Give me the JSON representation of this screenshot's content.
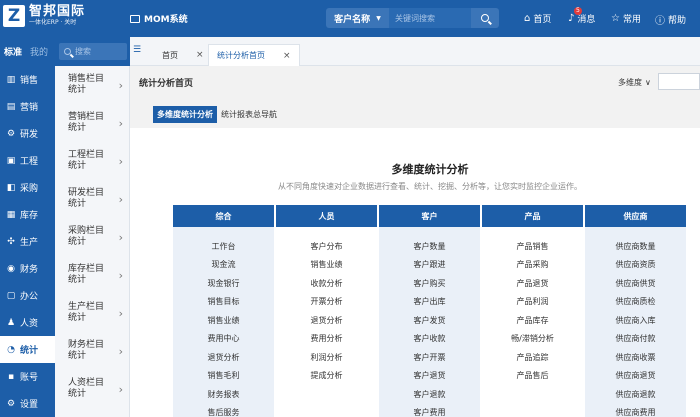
{
  "header": {
    "logo_mark": "Z",
    "logo_name": "智邦国际",
    "logo_sub": "一体化ERP · 关时",
    "system_name": "MOM系统",
    "search": {
      "category": "客户名称",
      "placeholder": "关键词搜索"
    },
    "nav": {
      "home": "首页",
      "messages": "消息",
      "message_count": "5",
      "favorites": "常用",
      "help": "帮助"
    }
  },
  "sidebar": {
    "tabs": {
      "standard": "标准",
      "mine": "我的"
    },
    "search_placeholder": "搜索",
    "items": [
      {
        "icon": "chart-icon",
        "glyph": "▥",
        "label": "销售"
      },
      {
        "icon": "marketing-icon",
        "glyph": "▤",
        "label": "营销"
      },
      {
        "icon": "rnd-icon",
        "glyph": "⚙",
        "label": "研发"
      },
      {
        "icon": "engineering-icon",
        "glyph": "▣",
        "label": "工程"
      },
      {
        "icon": "purchase-icon",
        "glyph": "◧",
        "label": "采购"
      },
      {
        "icon": "inventory-icon",
        "glyph": "▦",
        "label": "库存"
      },
      {
        "icon": "production-icon",
        "glyph": "✣",
        "label": "生产"
      },
      {
        "icon": "finance-icon",
        "glyph": "◉",
        "label": "财务"
      },
      {
        "icon": "office-icon",
        "glyph": "▢",
        "label": "办公"
      },
      {
        "icon": "hr-icon",
        "glyph": "♟",
        "label": "人资"
      },
      {
        "icon": "stats-icon",
        "glyph": "◔",
        "label": "统计"
      },
      {
        "icon": "account-icon",
        "glyph": "▪",
        "label": "账号"
      },
      {
        "icon": "settings-icon",
        "glyph": "⚙",
        "label": "设置"
      }
    ],
    "active_index": 10,
    "sub_items": [
      "销售栏目统计",
      "营销栏目统计",
      "工程栏目统计",
      "研发栏目统计",
      "采购栏目统计",
      "库存栏目统计",
      "生产栏目统计",
      "财务栏目统计",
      "人资栏目统计"
    ]
  },
  "tabs": [
    {
      "label": "首页",
      "active": false
    },
    {
      "label": "统计分析首页",
      "active": true
    }
  ],
  "content": {
    "breadcrumb": "统计分析首页",
    "dimension_label": "多维度",
    "sub_tabs": [
      {
        "label": "多维度统计分析",
        "active": true
      },
      {
        "label": "统计报表总导航",
        "active": false
      }
    ],
    "title": "多维度统计分析",
    "subtitle": "从不同角度快速对企业数据进行查看、统计、挖掘、分析等，让您实时监控企业运作。",
    "columns": [
      {
        "header": "综合",
        "items": [
          "工作台",
          "现金流",
          "现金银行",
          "销售目标",
          "销售业绩",
          "费用中心",
          "退货分析",
          "销售毛利",
          "财务报表",
          "售后服务"
        ]
      },
      {
        "header": "人员",
        "items": [
          "客户分布",
          "销售业绩",
          "收款分析",
          "开票分析",
          "退货分析",
          "费用分析",
          "利润分析",
          "提成分析"
        ]
      },
      {
        "header": "客户",
        "items": [
          "客户数量",
          "客户跟进",
          "客户购买",
          "客户出库",
          "客户发货",
          "客户收款",
          "客户开票",
          "客户退货",
          "客户退款",
          "客户费用"
        ]
      },
      {
        "header": "产品",
        "items": [
          "产品销售",
          "产品采购",
          "产品退货",
          "产品利润",
          "产品库存",
          "畅/滞销分析",
          "产品追踪",
          "产品售后"
        ]
      },
      {
        "header": "供应商",
        "items": [
          "供应商数量",
          "供应商资质",
          "供应商供货",
          "供应商质检",
          "供应商入库",
          "供应商付款",
          "供应商收票",
          "供应商退货",
          "供应商退款",
          "供应商费用"
        ]
      }
    ]
  },
  "colors": {
    "brand": "#1d5ea8",
    "badge": "#e23b3b"
  }
}
